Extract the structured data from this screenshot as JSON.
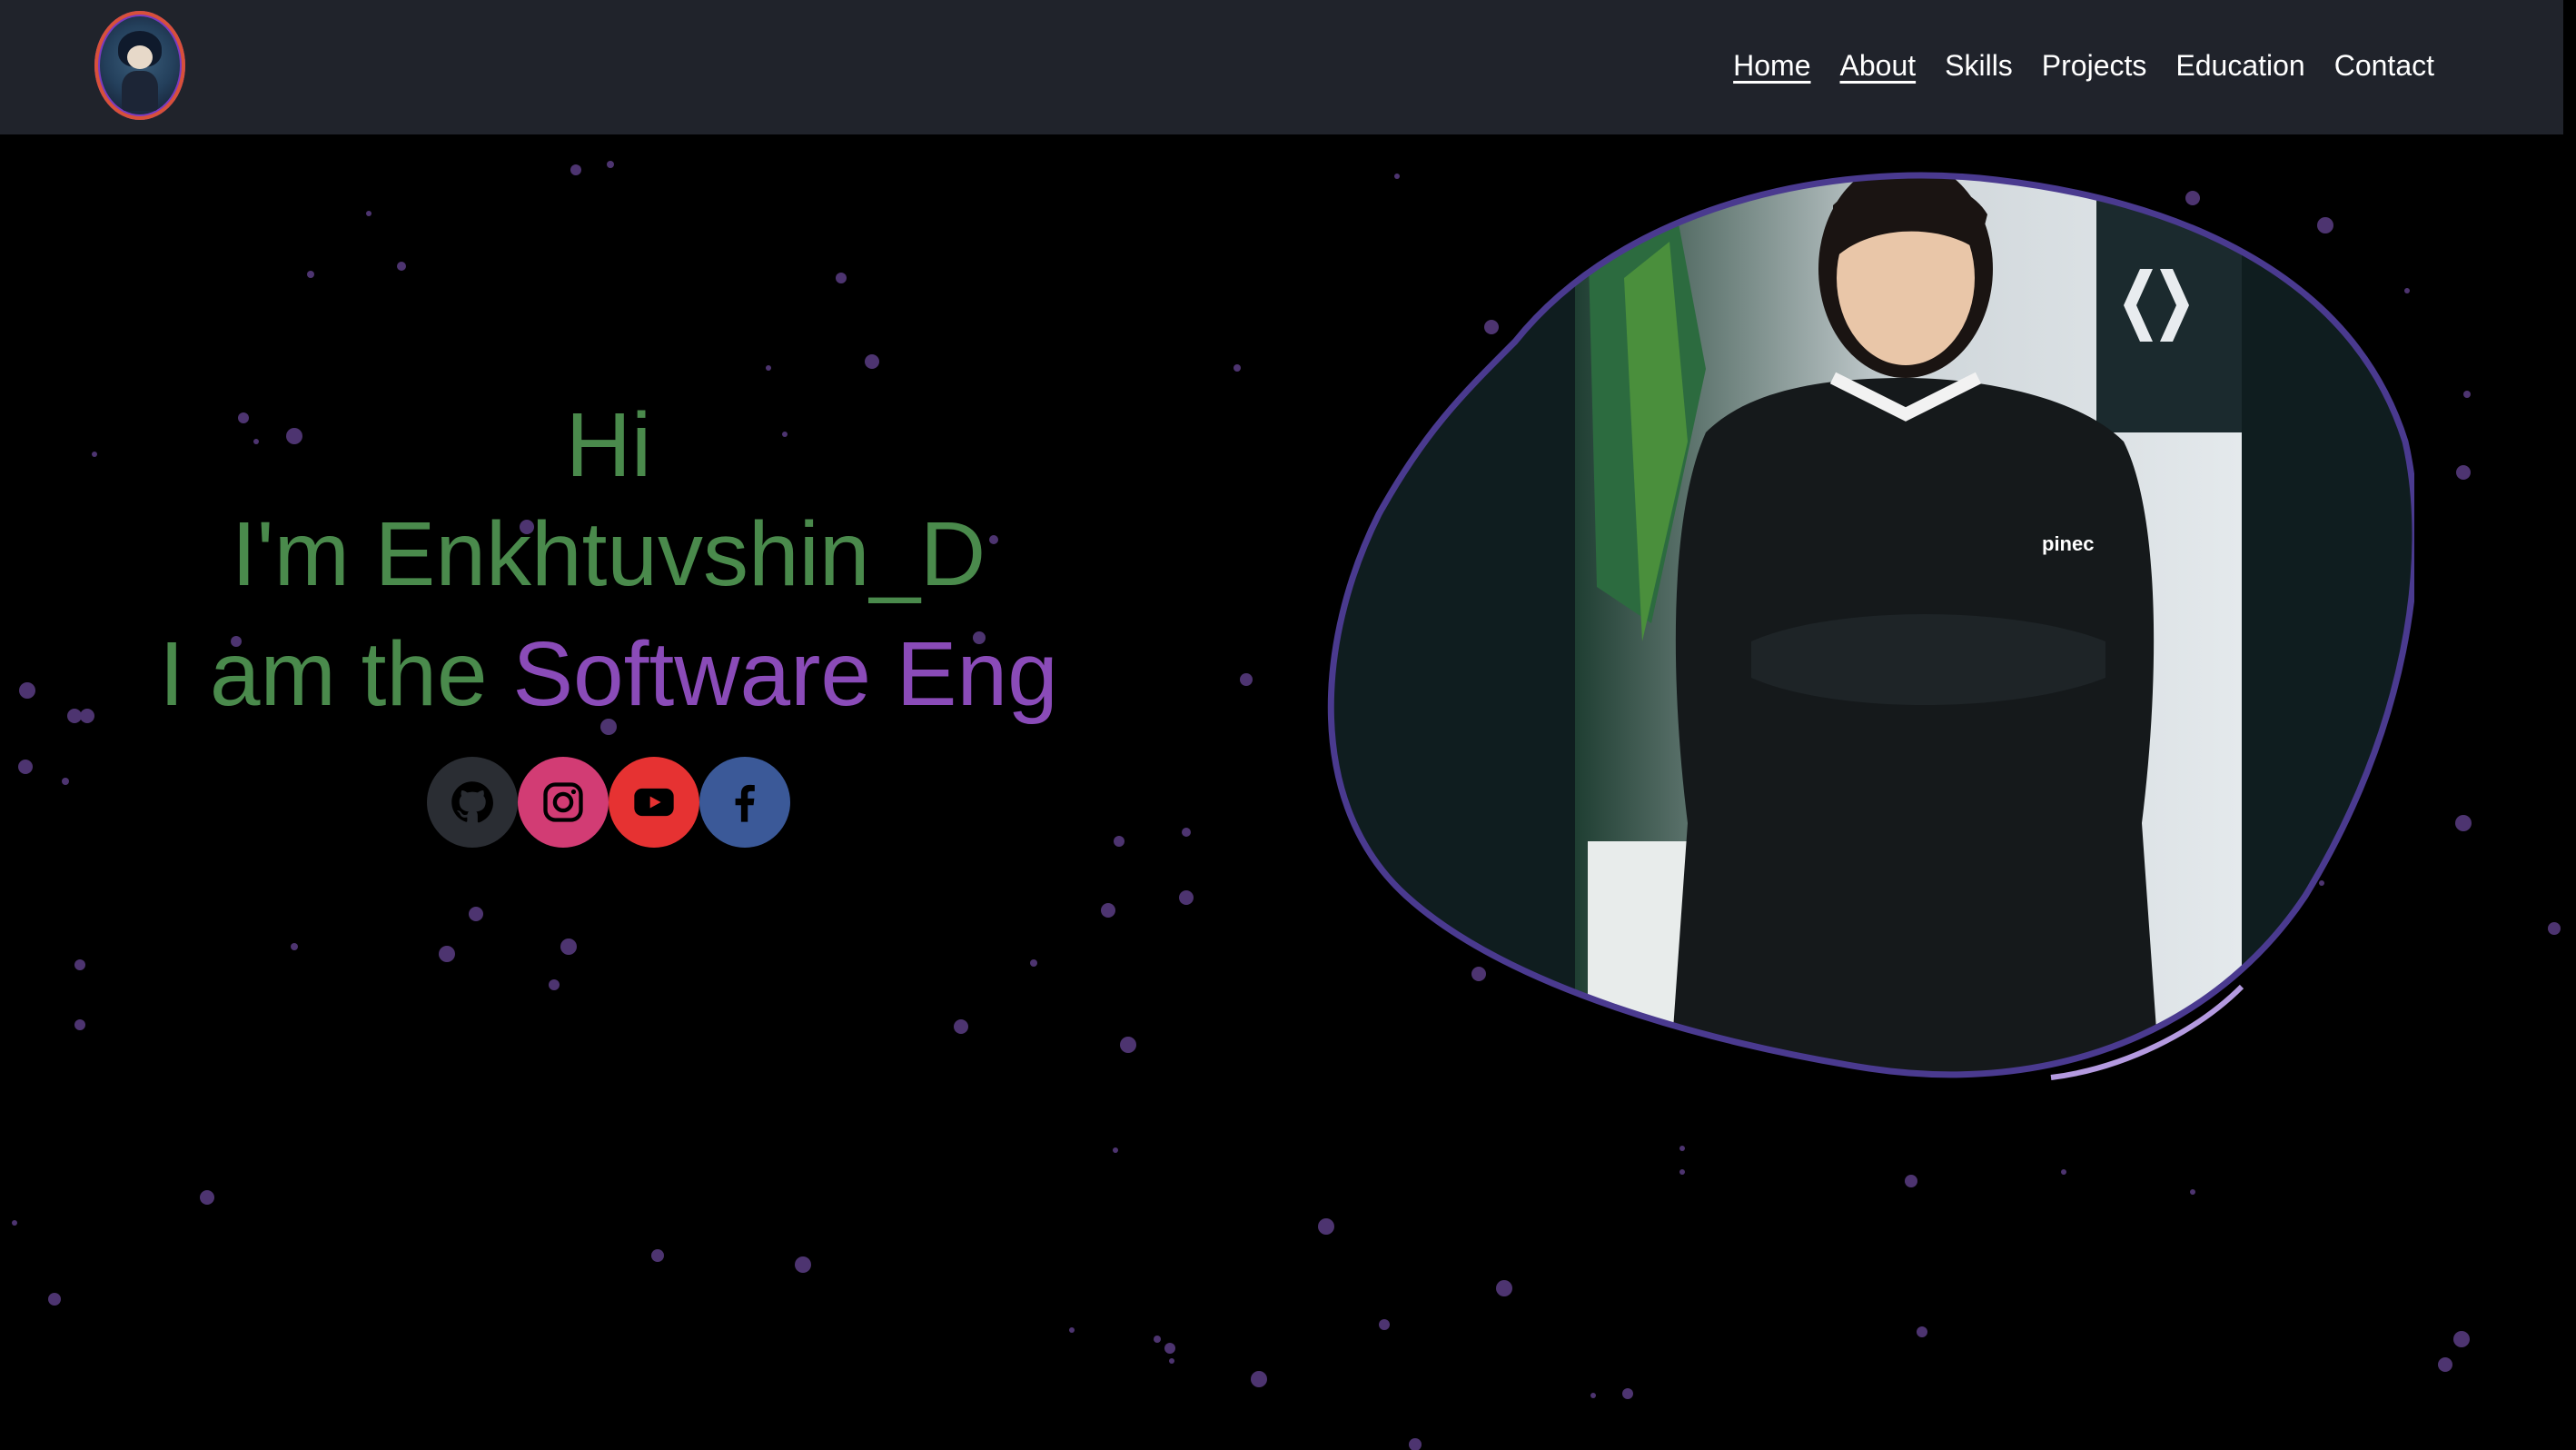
{
  "navbar": {
    "logo_name": "avatar-logo",
    "links": [
      {
        "label": "Home",
        "underlined": true
      },
      {
        "label": "About",
        "underlined": true
      },
      {
        "label": "Skills",
        "underlined": false
      },
      {
        "label": "Projects",
        "underlined": false
      },
      {
        "label": "Education",
        "underlined": false
      },
      {
        "label": "Contact",
        "underlined": false
      }
    ]
  },
  "hero": {
    "greeting": "Hi",
    "intro": "I'm Enkhtuvshin_D",
    "role_prefix": "I am the ",
    "role_typed": "Software Eng"
  },
  "socials": [
    {
      "name": "github",
      "icon": "github-icon",
      "color": "#2a2d33"
    },
    {
      "name": "instagram",
      "icon": "instagram-icon",
      "color": "#d23c74"
    },
    {
      "name": "youtube",
      "icon": "youtube-icon",
      "color": "#e63232"
    },
    {
      "name": "facebook",
      "icon": "facebook-icon",
      "color": "#3b5998"
    }
  ],
  "hoodie_logo_text": "pinec",
  "colors": {
    "background": "#000000",
    "navbar": "#20232b",
    "hero_green": "#4a8a4c",
    "accent_purple": "#8a4bb8",
    "blob_border": "#4a3a8f",
    "particle": "#5a3a80"
  }
}
